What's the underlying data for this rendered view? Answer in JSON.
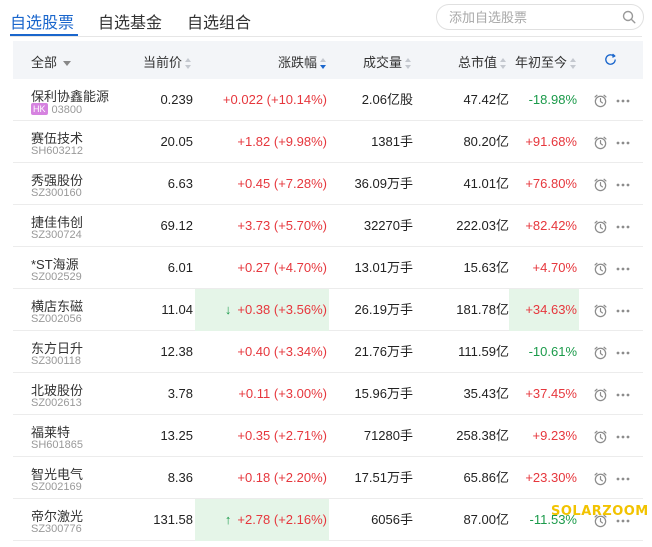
{
  "tabs": [
    {
      "label": "自选股票",
      "active": true
    },
    {
      "label": "自选基金",
      "active": false
    },
    {
      "label": "自选组合",
      "active": false
    }
  ],
  "search": {
    "placeholder": "添加自选股票"
  },
  "columns": {
    "all": "全部",
    "price": "当前价",
    "change": "涨跌幅",
    "volume": "成交量",
    "market_cap": "总市值",
    "ytd": "年初至今"
  },
  "rows": [
    {
      "name": "保利协鑫能源",
      "market": "HK",
      "code": "03800",
      "price": "0.239",
      "change": "+0.022 (+10.14%)",
      "volume": "2.06亿股",
      "market_cap": "47.42亿",
      "ytd": "-18.98%",
      "change_dir": "up",
      "ytd_dir": "down",
      "change_highlight": false,
      "ytd_highlight": false,
      "arrow": ""
    },
    {
      "name": "赛伍技术",
      "market": "",
      "code": "SH603212",
      "price": "20.05",
      "change": "+1.82 (+9.98%)",
      "volume": "1381手",
      "market_cap": "80.20亿",
      "ytd": "+91.68%",
      "change_dir": "up",
      "ytd_dir": "up",
      "change_highlight": false,
      "ytd_highlight": false,
      "arrow": ""
    },
    {
      "name": "秀强股份",
      "market": "",
      "code": "SZ300160",
      "price": "6.63",
      "change": "+0.45 (+7.28%)",
      "volume": "36.09万手",
      "market_cap": "41.01亿",
      "ytd": "+76.80%",
      "change_dir": "up",
      "ytd_dir": "up",
      "change_highlight": false,
      "ytd_highlight": false,
      "arrow": ""
    },
    {
      "name": "捷佳伟创",
      "market": "",
      "code": "SZ300724",
      "price": "69.12",
      "change": "+3.73 (+5.70%)",
      "volume": "32270手",
      "market_cap": "222.03亿",
      "ytd": "+82.42%",
      "change_dir": "up",
      "ytd_dir": "up",
      "change_highlight": false,
      "ytd_highlight": false,
      "arrow": ""
    },
    {
      "name": "*ST海源",
      "market": "",
      "code": "SZ002529",
      "price": "6.01",
      "change": "+0.27 (+4.70%)",
      "volume": "13.01万手",
      "market_cap": "15.63亿",
      "ytd": "+4.70%",
      "change_dir": "up",
      "ytd_dir": "up",
      "change_highlight": false,
      "ytd_highlight": false,
      "arrow": ""
    },
    {
      "name": "横店东磁",
      "market": "",
      "code": "SZ002056",
      "price": "11.04",
      "change": "+0.38 (+3.56%)",
      "volume": "26.19万手",
      "market_cap": "181.78亿",
      "ytd": "+34.63%",
      "change_dir": "up",
      "ytd_dir": "up",
      "change_highlight": true,
      "ytd_highlight": true,
      "arrow": "↓"
    },
    {
      "name": "东方日升",
      "market": "",
      "code": "SZ300118",
      "price": "12.38",
      "change": "+0.40 (+3.34%)",
      "volume": "21.76万手",
      "market_cap": "111.59亿",
      "ytd": "-10.61%",
      "change_dir": "up",
      "ytd_dir": "down",
      "change_highlight": false,
      "ytd_highlight": false,
      "arrow": ""
    },
    {
      "name": "北玻股份",
      "market": "",
      "code": "SZ002613",
      "price": "3.78",
      "change": "+0.11 (+3.00%)",
      "volume": "15.96万手",
      "market_cap": "35.43亿",
      "ytd": "+37.45%",
      "change_dir": "up",
      "ytd_dir": "up",
      "change_highlight": false,
      "ytd_highlight": false,
      "arrow": ""
    },
    {
      "name": "福莱特",
      "market": "",
      "code": "SH601865",
      "price": "13.25",
      "change": "+0.35 (+2.71%)",
      "volume": "71280手",
      "market_cap": "258.38亿",
      "ytd": "+9.23%",
      "change_dir": "up",
      "ytd_dir": "up",
      "change_highlight": false,
      "ytd_highlight": false,
      "arrow": ""
    },
    {
      "name": "智光电气",
      "market": "",
      "code": "SZ002169",
      "price": "8.36",
      "change": "+0.18 (+2.20%)",
      "volume": "17.51万手",
      "market_cap": "65.86亿",
      "ytd": "+23.30%",
      "change_dir": "up",
      "ytd_dir": "up",
      "change_highlight": false,
      "ytd_highlight": false,
      "arrow": ""
    },
    {
      "name": "帝尔激光",
      "market": "",
      "code": "SZ300776",
      "price": "131.58",
      "change": "+2.78 (+2.16%)",
      "volume": "6056手",
      "market_cap": "87.00亿",
      "ytd": "-11.53%",
      "change_dir": "up",
      "ytd_dir": "down",
      "change_highlight": true,
      "ytd_highlight": false,
      "arrow": "↑"
    }
  ],
  "watermark": "SOLARZOOM",
  "colors": {
    "accent": "#1a66cc",
    "up": "#e6373d",
    "down": "#1b9a4a",
    "highlight": "#e5f5e8",
    "watermark": "#f2c300"
  }
}
